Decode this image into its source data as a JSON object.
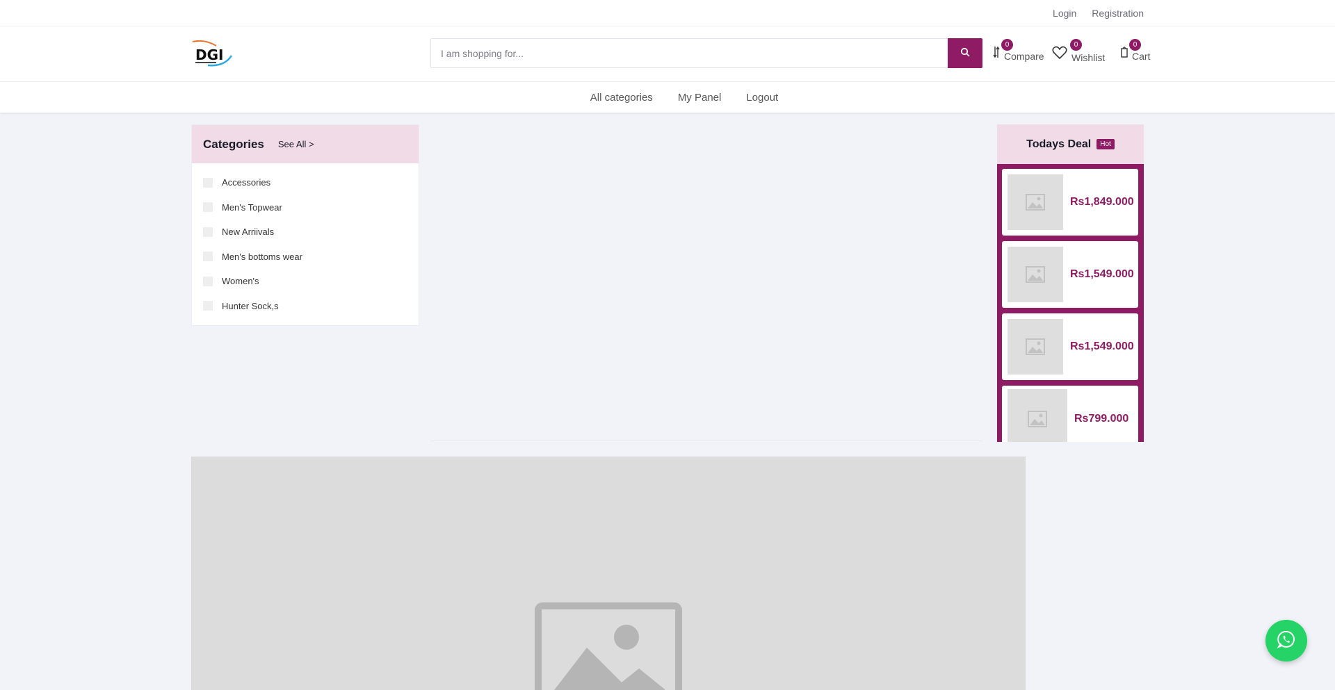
{
  "topbar": {
    "login": "Login",
    "registration": "Registration"
  },
  "header": {
    "search_placeholder": "I am shopping for...",
    "compare": {
      "label": "Compare",
      "count": "0"
    },
    "wishlist": {
      "label": "Wishlist",
      "count": "0"
    },
    "cart": {
      "label": "Cart",
      "count": "0"
    }
  },
  "nav": {
    "items": [
      "All categories",
      "My Panel",
      "Logout"
    ]
  },
  "categories": {
    "title": "Categories",
    "see_all": "See All >",
    "items": [
      "Accessories",
      "Men's Topwear",
      "New Arriivals",
      "Men's bottoms wear",
      "Women's",
      "Hunter Sock,s"
    ]
  },
  "todays_deal": {
    "title": "Todays Deal",
    "badge": "Hot",
    "items": [
      {
        "price": "Rs1,849.000"
      },
      {
        "price": "Rs1,549.000"
      },
      {
        "price": "Rs1,549.000"
      },
      {
        "price": "Rs799.000"
      }
    ]
  },
  "colors": {
    "accent": "#8e1b63",
    "accent_light": "#f1dbe7",
    "whatsapp": "#25d366"
  }
}
